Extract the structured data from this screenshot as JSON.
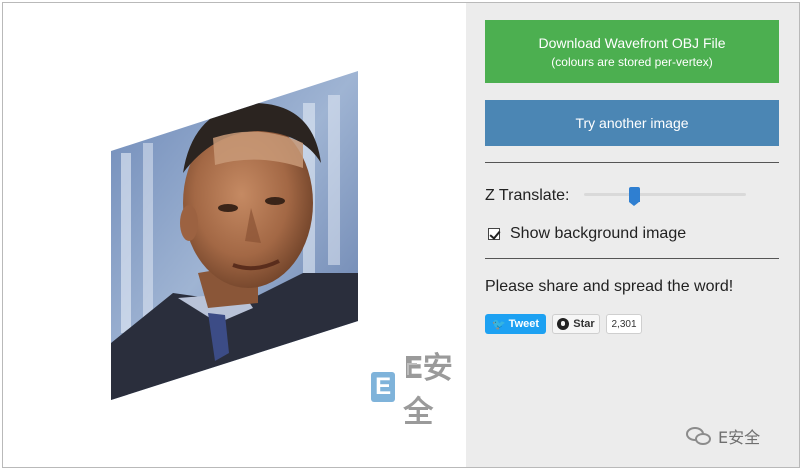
{
  "buttons": {
    "download_main": "Download Wavefront OBJ File",
    "download_sub": "(colours are stored per-vertex)",
    "try_again": "Try another image"
  },
  "controls": {
    "z_translate_label": "Z Translate:",
    "z_translate_value": 0.3,
    "show_background_label": "Show background image",
    "show_background_checked": true
  },
  "share": {
    "text": "Please share and spread the word!",
    "tweet_label": "Tweet",
    "star_label": "Star",
    "star_count": "2,301"
  },
  "watermark": {
    "center_letter": "E",
    "center_text": "E安全",
    "corner_text": "E安全"
  },
  "icons": [
    "twitter-bird-icon",
    "github-octocat-icon",
    "checkbox-checked-icon",
    "wechat-icon"
  ],
  "colors": {
    "download_button": "#4caf50",
    "try_button": "#4b86b4",
    "sidebar_bg": "#ececec",
    "tweet_button": "#1da1f2",
    "slider_thumb": "#2f7fd1"
  }
}
